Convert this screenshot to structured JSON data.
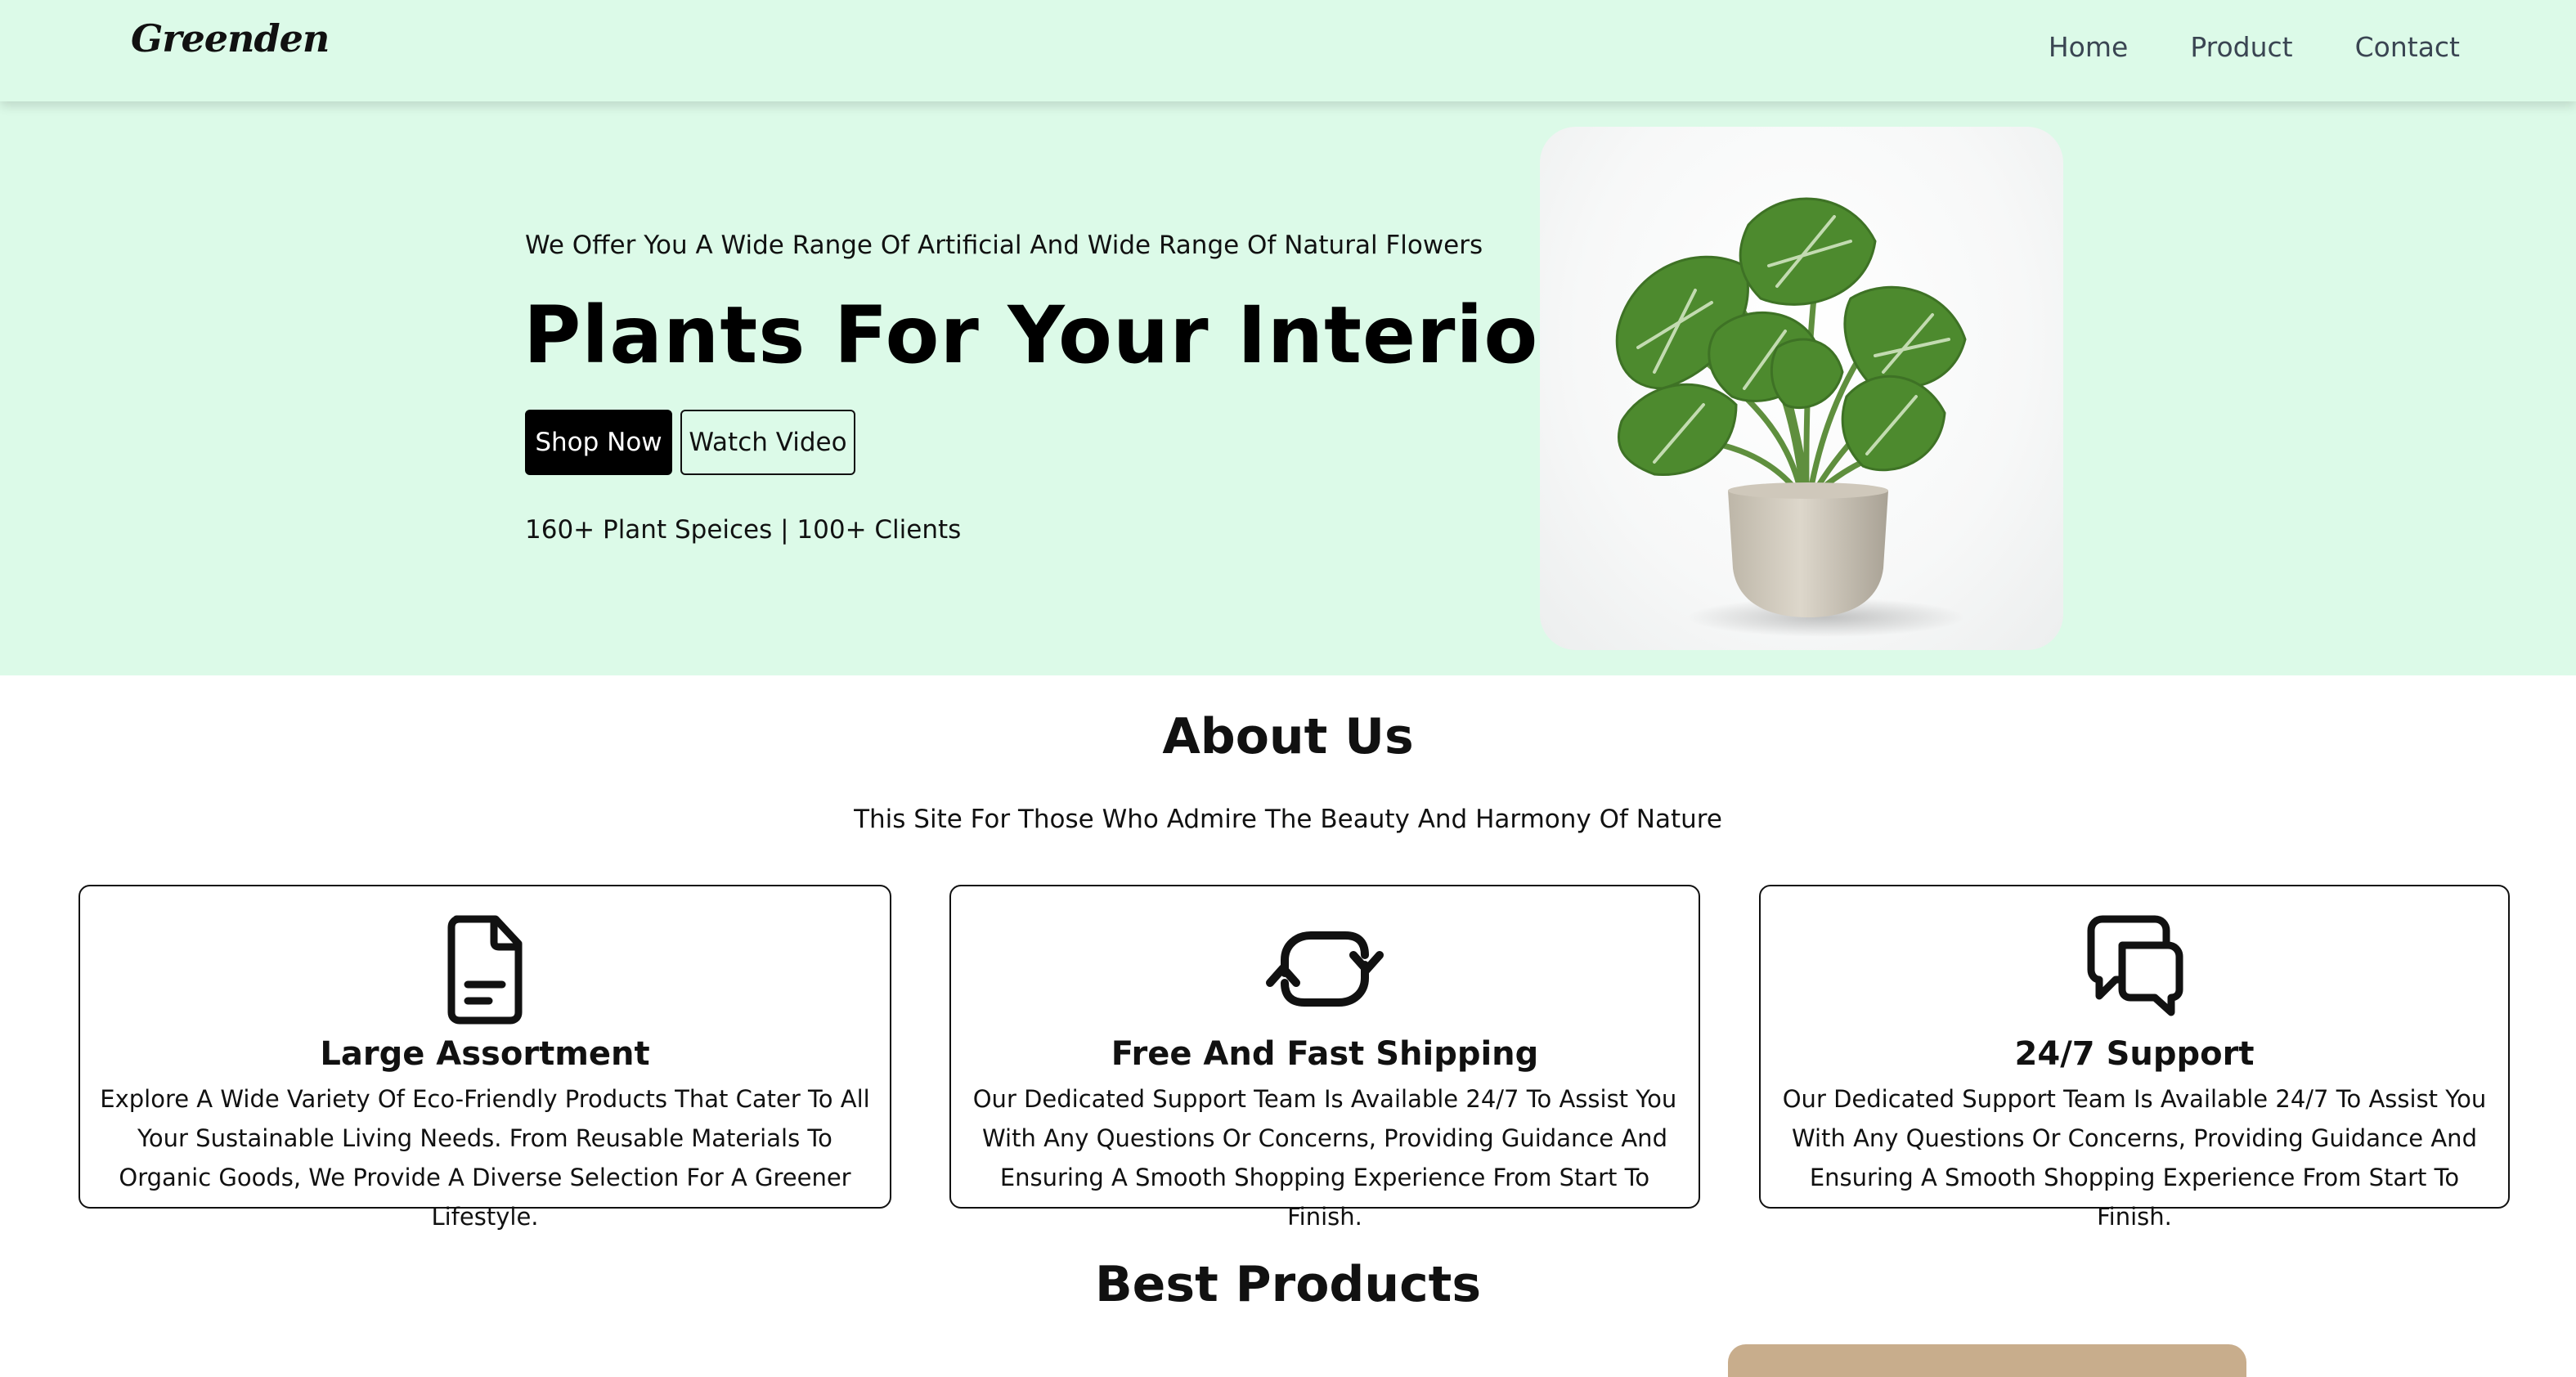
{
  "nav": {
    "logo": "Greenden",
    "links": [
      "Home",
      "Product",
      "Contact"
    ]
  },
  "hero": {
    "tagline": "We Offer You A Wide Range Of Artificial And Wide Range Of Natural Flowers",
    "title": "Plants For Your Interior",
    "buttons": {
      "shop": "Shop Now",
      "watch": "Watch Video"
    },
    "stats": "160+ Plant Speices | 100+ Clients",
    "image_icon": "monstera-plant-in-pot"
  },
  "about": {
    "title": "About Us",
    "subtitle": "This Site For Those Who Admire The Beauty And Harmony Of Nature",
    "cards": [
      {
        "icon": "document-icon",
        "title": "Large Assortment",
        "text": "Explore A Wide Variety Of Eco-Friendly Products That Cater To All Your Sustainable Living Needs. From Reusable Materials To Organic Goods, We Provide A Diverse Selection For A Greener Lifestyle."
      },
      {
        "icon": "refresh-icon",
        "title": "Free And Fast Shipping",
        "text": "Our Dedicated Support Team Is Available 24/7 To Assist You With Any Questions Or Concerns, Providing Guidance And Ensuring A Smooth Shopping Experience From Start To Finish."
      },
      {
        "icon": "chat-bubbles-icon",
        "title": "24/7 Support",
        "text": "Our Dedicated Support Team Is Available 24/7 To Assist You With Any Questions Or Concerns, Providing Guidance And Ensuring A Smooth Shopping Experience From Start To Finish."
      }
    ]
  },
  "best_products": {
    "title": "Best Products"
  },
  "colors": {
    "mint_background": "#dcfae8",
    "primary_button": "#000000",
    "text": "#111111",
    "nav_link": "#3a4552"
  }
}
